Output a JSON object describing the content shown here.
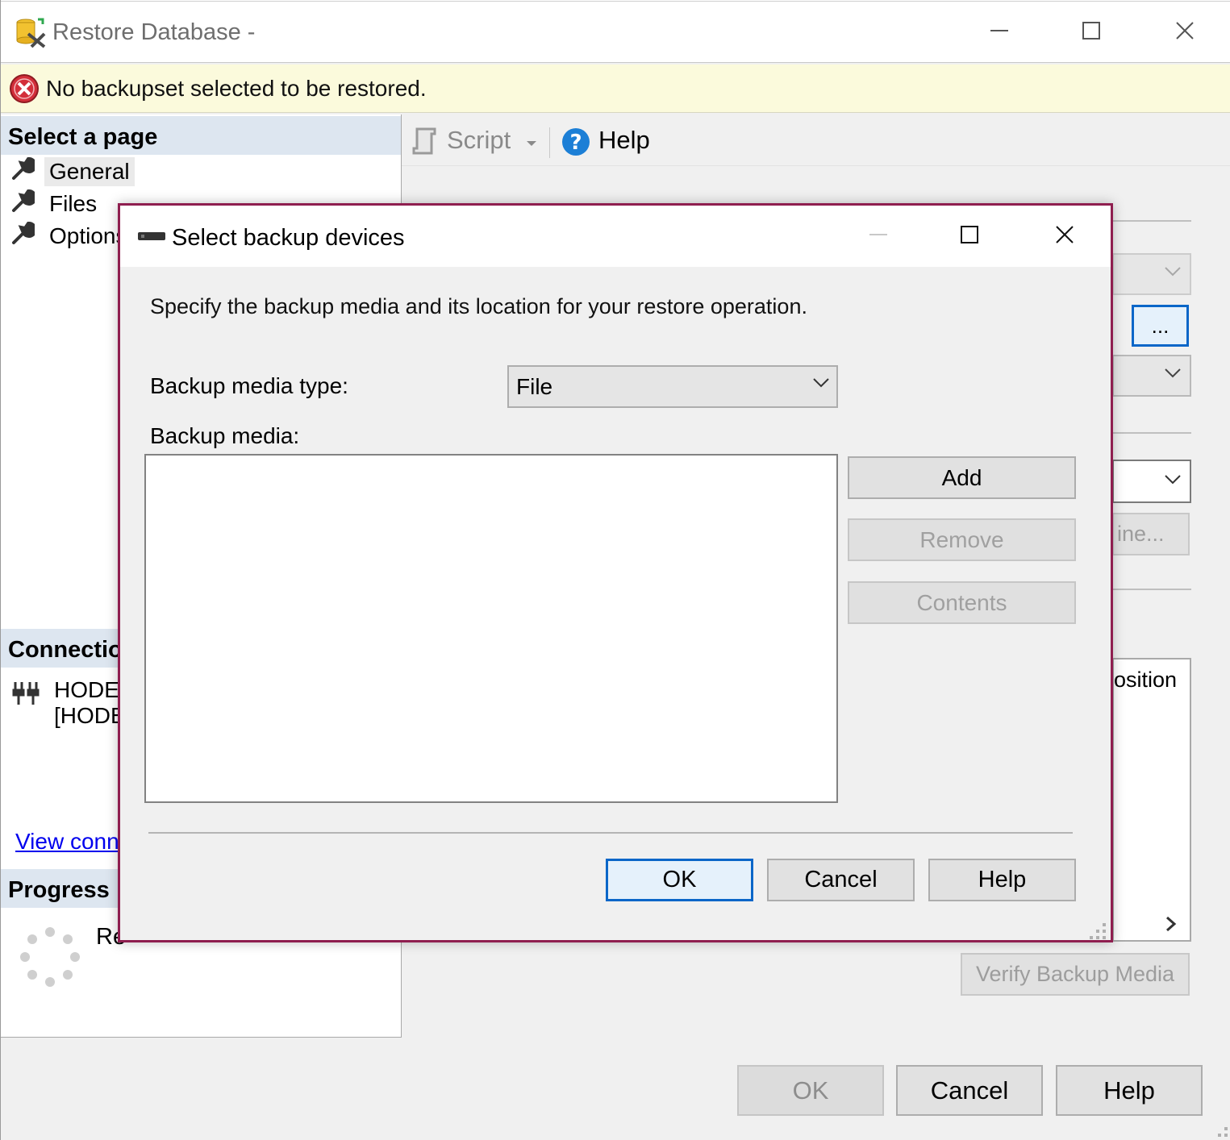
{
  "window": {
    "title": "Restore Database -",
    "controls": {
      "minimize": "minimize",
      "maximize": "maximize",
      "close": "close"
    }
  },
  "message_bar": {
    "text": "No backupset selected to be restored."
  },
  "left_panel": {
    "select_page_header": "Select a page",
    "pages": [
      {
        "label": "General",
        "selected": true
      },
      {
        "label": "Files"
      },
      {
        "label": "Options"
      }
    ],
    "connection_header": "Connectio",
    "connection_server": "HODE",
    "connection_login": "[HODE",
    "view_connection_link": "View conne",
    "progress_header": "Progress",
    "progress_status": "Re"
  },
  "toolbar": {
    "script_label": "Script",
    "help_label": "Help"
  },
  "background_form": {
    "browse_button": "...",
    "timeline_button_fragment": "ine...",
    "grid_column_fragment": "osition",
    "verify_button": "Verify Backup Media"
  },
  "main_buttons": {
    "ok": "OK",
    "cancel": "Cancel",
    "help": "Help"
  },
  "dialog": {
    "title": "Select backup devices",
    "instruction": "Specify the backup media and its location for your restore operation.",
    "media_type_label": "Backup media type:",
    "media_type_value": "File",
    "backup_media_label": "Backup media:",
    "backup_media_items": [],
    "add_button": "Add",
    "remove_button": "Remove",
    "contents_button": "Contents",
    "ok_button": "OK",
    "cancel_button": "Cancel",
    "help_button": "Help"
  },
  "colors": {
    "accent_border": "#8f1e4f",
    "focus_blue": "#0a66c8",
    "message_bar": "#fbfadc",
    "section_header": "#dde6f0",
    "link": "#0000ee"
  }
}
